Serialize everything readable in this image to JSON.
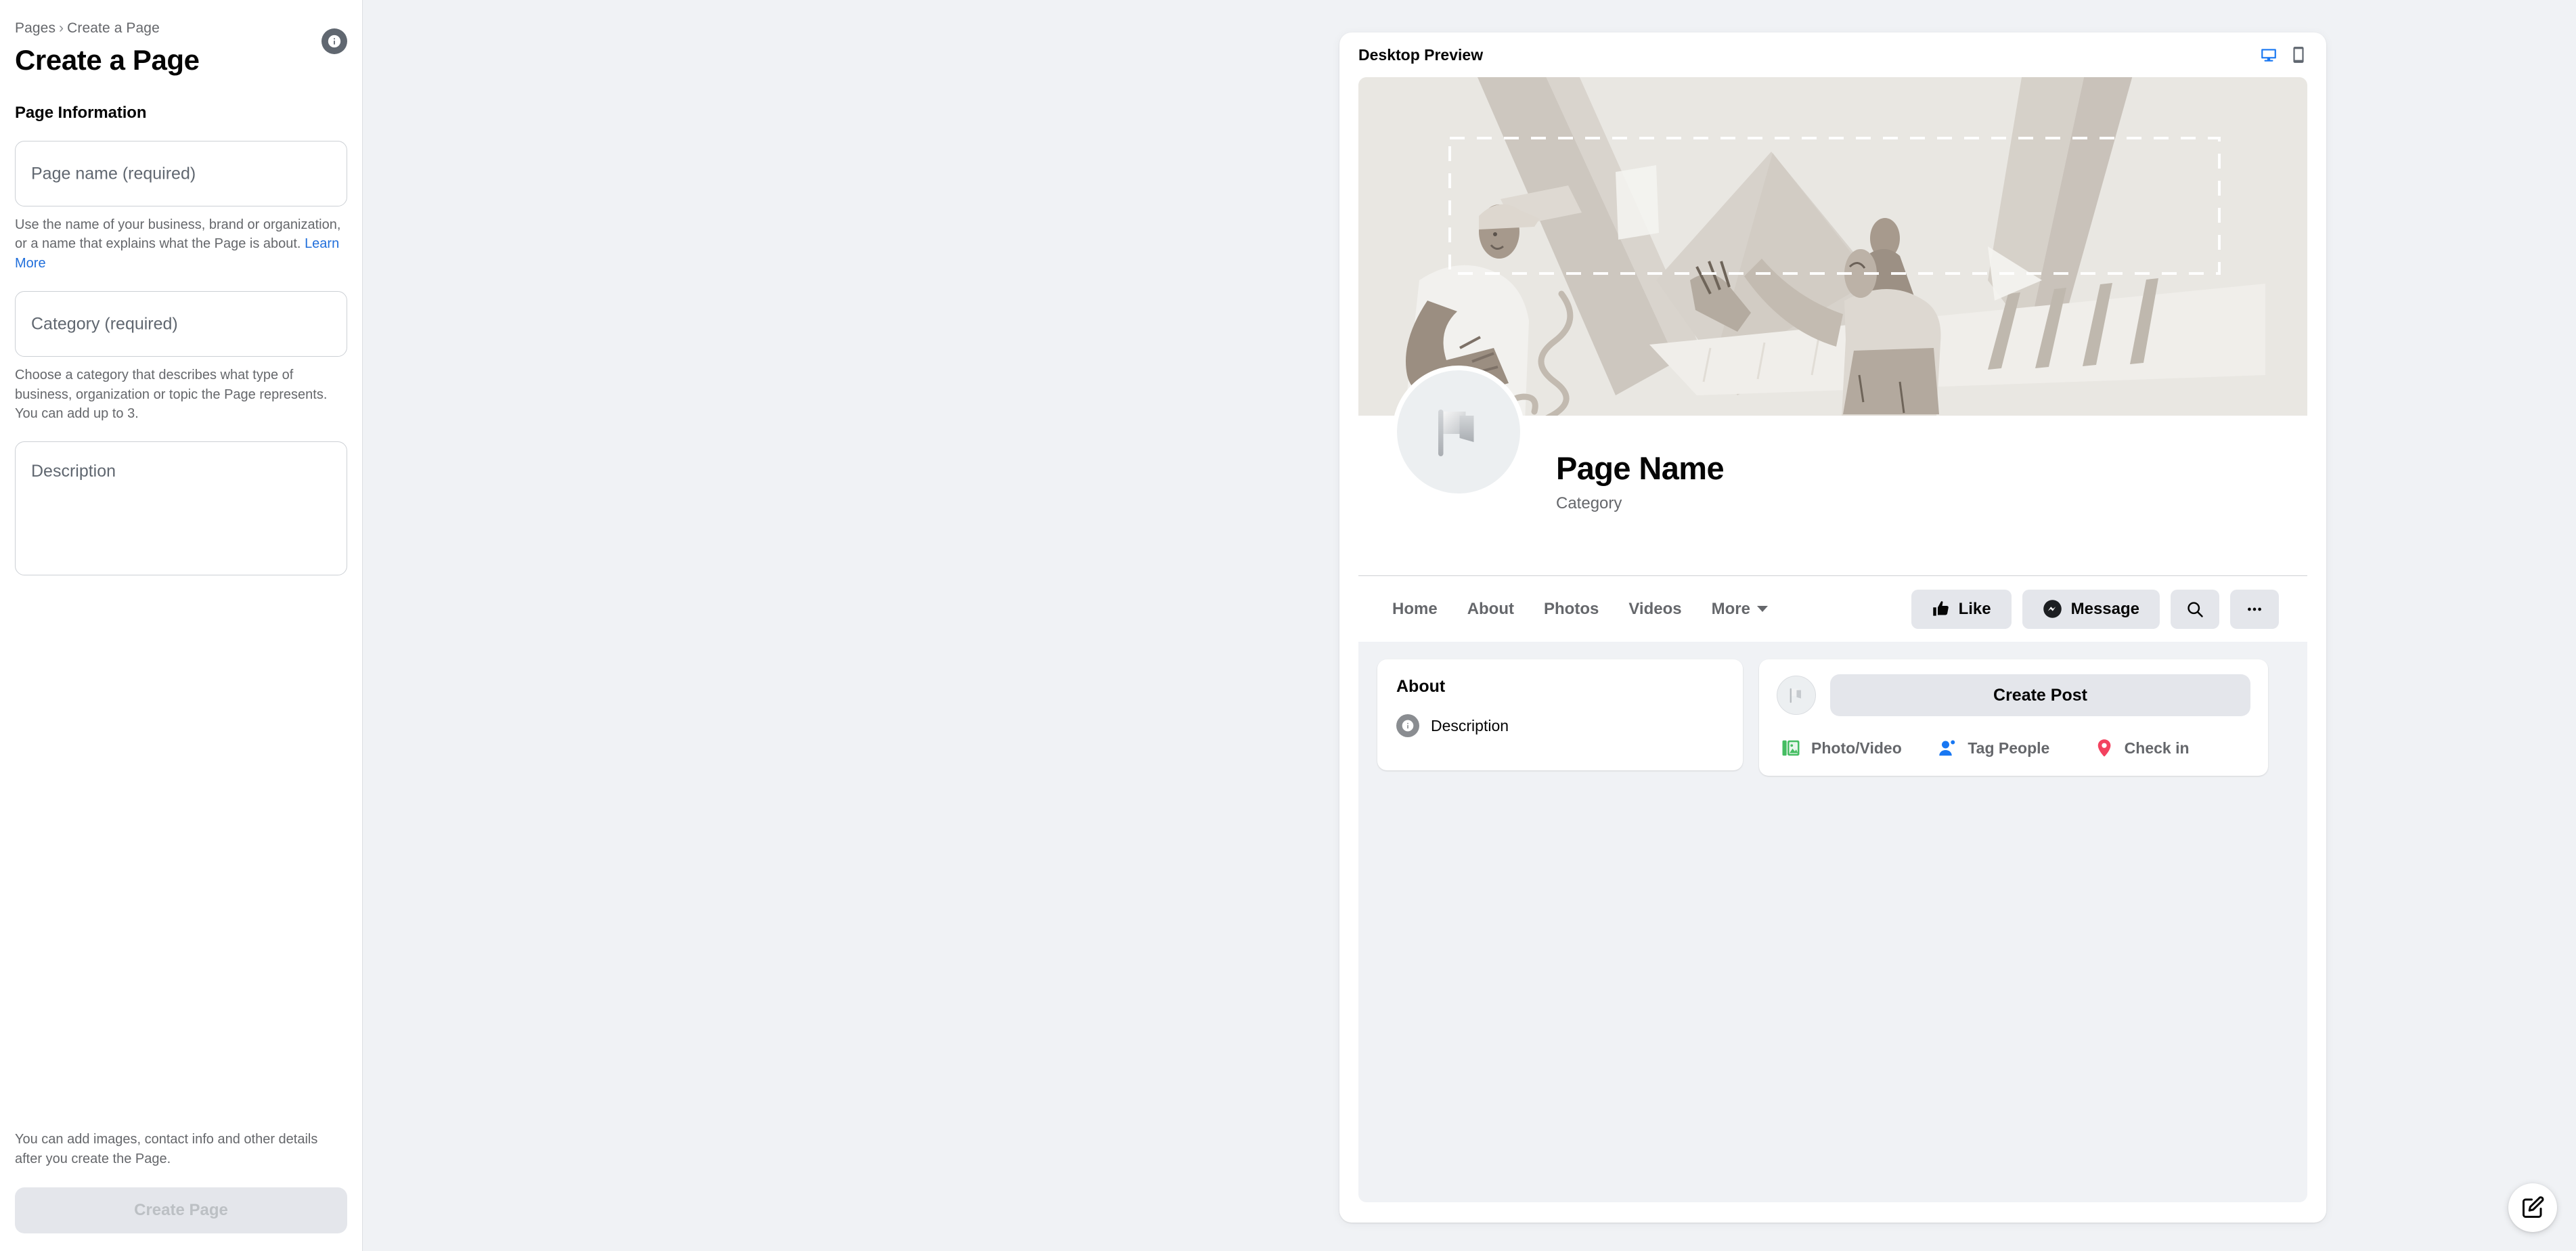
{
  "left": {
    "breadcrumb": {
      "root": "Pages",
      "separator": "›",
      "current": "Create a Page"
    },
    "title": "Create a Page",
    "info_icon": "info-icon",
    "section_title": "Page Information",
    "fields": {
      "page_name": {
        "placeholder": "Page name (required)",
        "value": "",
        "helper": "Use the name of your business, brand or organization, or a name that explains what the Page is about.",
        "helper_link": "Learn More"
      },
      "category": {
        "placeholder": "Category (required)",
        "value": "",
        "helper": "Choose a category that describes what type of business, organization or topic the Page represents. You can add up to 3."
      },
      "description": {
        "placeholder": "Description",
        "value": ""
      }
    },
    "footer": {
      "note": "You can add images, contact info and other details after you create the Page.",
      "submit_label": "Create Page"
    }
  },
  "preview": {
    "header_title": "Desktop Preview",
    "toggles": [
      {
        "name": "desktop-view-icon",
        "active": true,
        "color": "#1877f2"
      },
      {
        "name": "mobile-view-icon",
        "active": false,
        "color": "#606770"
      }
    ],
    "cover": {
      "alt": "cover-illustration",
      "bg": "#e9e7e2"
    },
    "profile": {
      "avatar_icon": "flag-icon",
      "page_name": "Page Name",
      "category": "Category"
    },
    "nav_tabs": [
      {
        "label": "Home"
      },
      {
        "label": "About"
      },
      {
        "label": "Photos"
      },
      {
        "label": "Videos"
      },
      {
        "label": "More",
        "has_caret": true
      }
    ],
    "nav_actions": [
      {
        "label": "Like",
        "icon": "thumbs-up-icon"
      },
      {
        "label": "Message",
        "icon": "messenger-icon"
      },
      {
        "label": "",
        "icon": "search-icon"
      },
      {
        "label": "",
        "icon": "ellipsis-icon"
      }
    ],
    "about_card": {
      "title": "About",
      "row_icon": "info-icon",
      "row_text": "Description"
    },
    "post_card": {
      "avatar_icon": "flag-icon",
      "create_post_label": "Create Post",
      "actions": [
        {
          "label": "Photo/Video",
          "icon": "photo-video-icon",
          "color": "#45bd62"
        },
        {
          "label": "Tag People",
          "icon": "tag-people-icon",
          "color": "#1877f2"
        },
        {
          "label": "Check in",
          "icon": "location-pin-icon",
          "color": "#f3425f"
        }
      ]
    }
  },
  "fab": {
    "name": "compose-icon",
    "label": ""
  },
  "colors": {
    "page_bg": "#f0f2f5",
    "panel_bg": "#ffffff",
    "accent_blue": "#1877f2",
    "link_blue": "#216fdb",
    "text_primary": "#050505",
    "text_secondary": "#65676b",
    "button_grey": "#e4e6eb"
  }
}
